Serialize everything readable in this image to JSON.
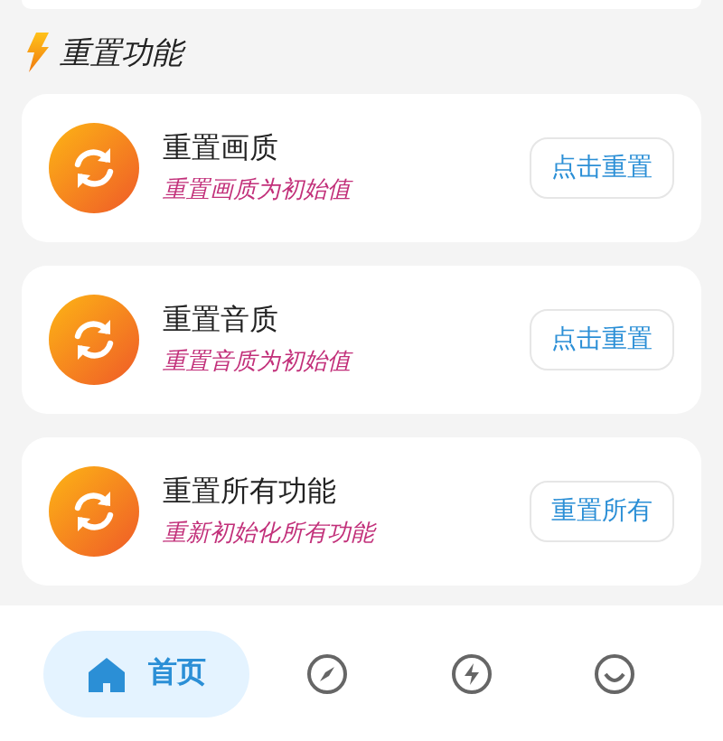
{
  "section": {
    "title": "重置功能"
  },
  "items": [
    {
      "title": "重置画质",
      "subtitle": "重置画质为初始值",
      "action": "点击重置"
    },
    {
      "title": "重置音质",
      "subtitle": "重置音质为初始值",
      "action": "点击重置"
    },
    {
      "title": "重置所有功能",
      "subtitle": "重新初始化所有功能",
      "action": "重置所有"
    }
  ],
  "nav": [
    {
      "label": "首页",
      "selected": true
    },
    {
      "selected": false
    },
    {
      "selected": false
    },
    {
      "selected": false
    }
  ]
}
